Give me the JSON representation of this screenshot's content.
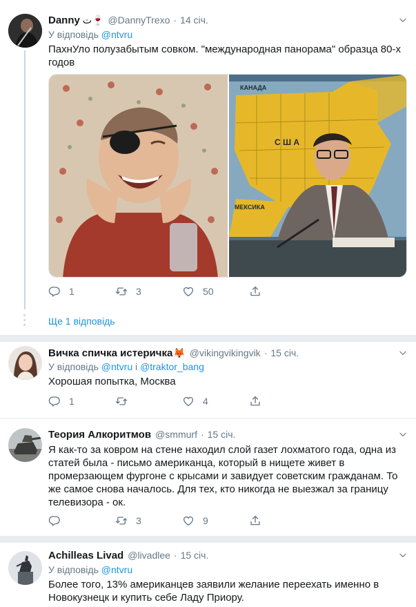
{
  "tweets": [
    {
      "author_name": "Danny",
      "author_emoji": "ت🍷",
      "handle": "@DannyTrexo",
      "time": "14 січ.",
      "reply_prefix": "У відповідь",
      "reply_to_1": "@ntvru",
      "text": "ПахнУло полузабытым совком. \"международная панорама\" образца 80-х годов",
      "media_right_labels": [
        "КАНАДА",
        "С Ш А",
        "МЕКСИКА"
      ],
      "replies": "1",
      "retweets": "3",
      "likes": "50",
      "more_replies": "Ще 1 відповідь"
    },
    {
      "author_name": "Вичка спичка истеричка",
      "author_emoji": "🦊",
      "handle": "@vikingvikingvik",
      "time": "15 січ.",
      "reply_prefix": "У відповідь",
      "reply_to_1": "@ntvru",
      "reply_joiner": "і",
      "reply_to_2": "@traktor_bang",
      "text": "Хорошая попытка, Москва",
      "replies": "1",
      "retweets": "",
      "likes": "4"
    },
    {
      "author_name": "Теория Алкоритмов",
      "handle": "@smmurf",
      "time": "15 січ.",
      "text": "Я как-то за ковром на стене находил слой газет лохматого года, одна из статей была - письмо американца, который в нищете живет в промерзающем фургоне с крысами и завидует советским гражданам. То же самое снова началось. Для тех, кто никогда не выезжал за границу телевизора - ок.",
      "replies": "",
      "retweets": "3",
      "likes": "9"
    },
    {
      "author_name": "Achilleas Livad",
      "handle": "@livadlee",
      "time": "15 січ.",
      "reply_prefix": "У відповідь",
      "reply_to_1": "@ntvru",
      "text": "Более того, 13% американцев заявили желание переехать именно в Новокузнецк и купить себе Ладу Приору."
    }
  ],
  "icons": {
    "reply": "reply-icon",
    "retweet": "retweet-icon",
    "like": "heart-icon",
    "share": "share-icon",
    "more": "chevron-down-icon"
  },
  "colors": {
    "link": "#1b95e0",
    "muted": "#657786",
    "divider": "#e6ecf0"
  }
}
